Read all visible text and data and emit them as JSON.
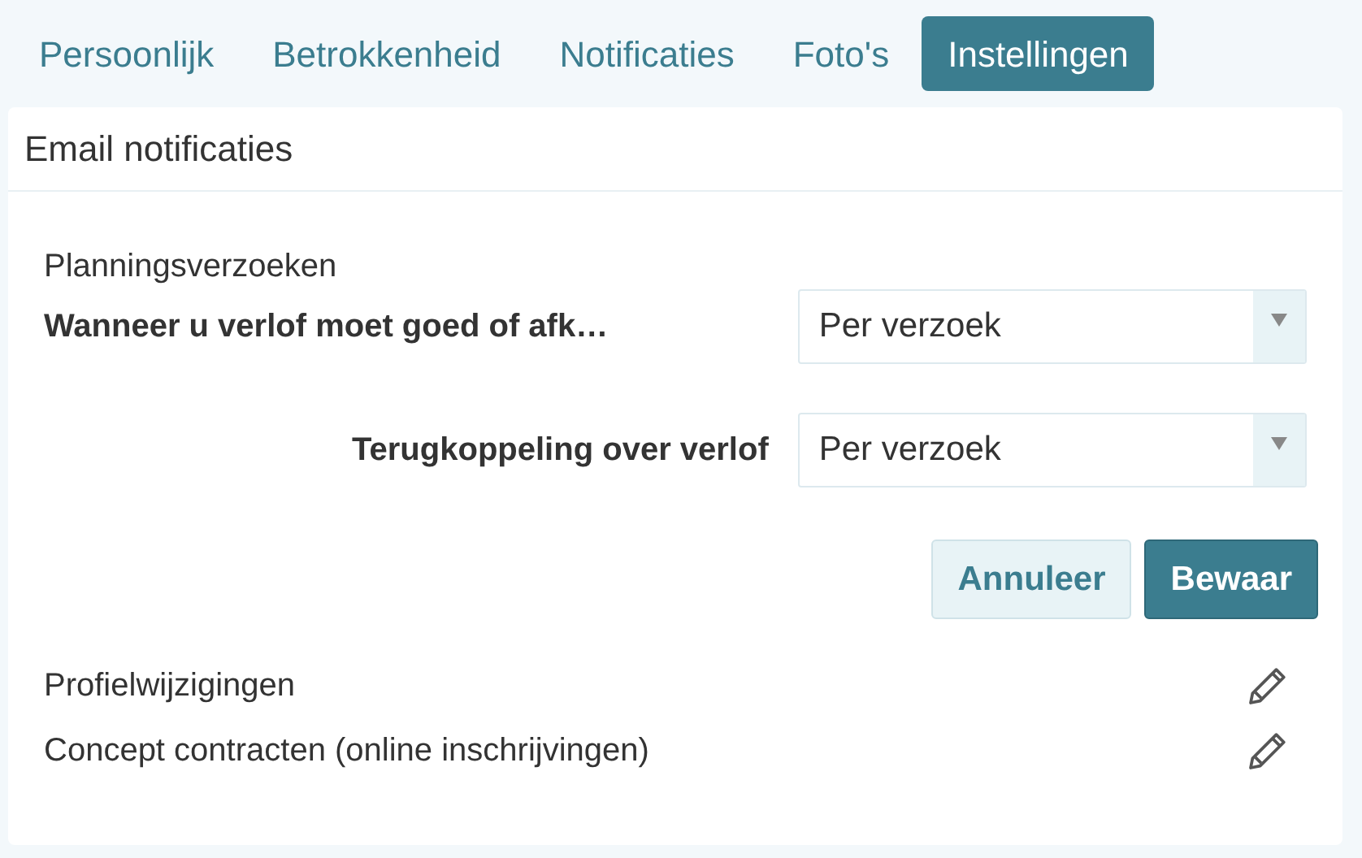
{
  "tabs": [
    {
      "label": "Persoonlijk",
      "selected": false
    },
    {
      "label": "Betrokkenheid",
      "selected": false
    },
    {
      "label": "Notificaties",
      "selected": false
    },
    {
      "label": "Foto's",
      "selected": false
    },
    {
      "label": "Instellingen",
      "selected": true
    }
  ],
  "card": {
    "title": "Email notificaties",
    "section_title": "Planningsverzoeken",
    "settings": [
      {
        "label": "Wanneer u verlof moet goed of afk…",
        "value": "Per verzoek"
      },
      {
        "label": "Terugkoppeling over verlof",
        "value": "Per verzoek"
      }
    ],
    "buttons": [
      {
        "label": "Annuleer",
        "kind": "secondary"
      },
      {
        "label": "Bewaar",
        "kind": "primary"
      }
    ],
    "items": [
      {
        "label": "Profielwijzigingen"
      },
      {
        "label": "Concept contracten (online inschrijvingen)"
      }
    ]
  }
}
